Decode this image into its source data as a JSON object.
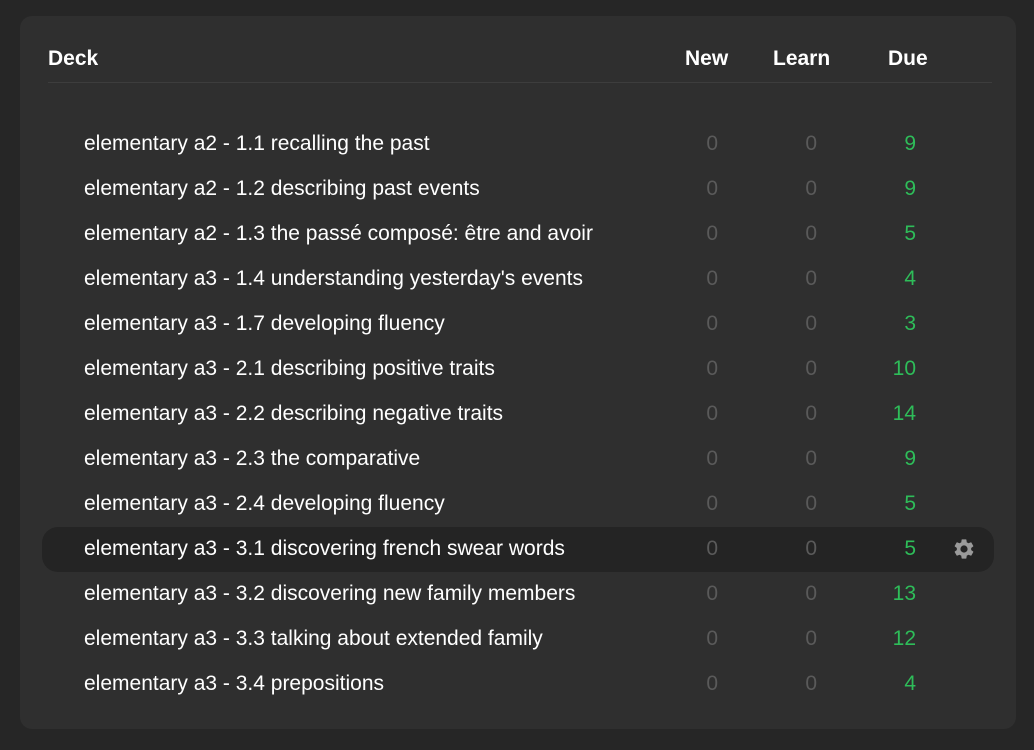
{
  "header": {
    "deck": "Deck",
    "new": "New",
    "learn": "Learn",
    "due": "Due"
  },
  "decks": [
    {
      "name": "elementary a2 - 1.1 recalling the past",
      "new": "0",
      "learn": "0",
      "due": "9"
    },
    {
      "name": "elementary a2 - 1.2 describing past events",
      "new": "0",
      "learn": "0",
      "due": "9"
    },
    {
      "name": "elementary a2 - 1.3 the passé composé: être and avoir",
      "new": "0",
      "learn": "0",
      "due": "5"
    },
    {
      "name": "elementary a3 - 1.4 understanding yesterday's events",
      "new": "0",
      "learn": "0",
      "due": "4"
    },
    {
      "name": "elementary a3 - 1.7 developing fluency",
      "new": "0",
      "learn": "0",
      "due": "3"
    },
    {
      "name": "elementary a3 - 2.1 describing positive traits",
      "new": "0",
      "learn": "0",
      "due": "10"
    },
    {
      "name": "elementary a3 - 2.2 describing negative traits",
      "new": "0",
      "learn": "0",
      "due": "14"
    },
    {
      "name": "elementary a3 - 2.3 the comparative",
      "new": "0",
      "learn": "0",
      "due": "9"
    },
    {
      "name": "elementary a3 - 2.4 developing fluency",
      "new": "0",
      "learn": "0",
      "due": "5"
    },
    {
      "name": "elementary a3 - 3.1 discovering french swear words",
      "new": "0",
      "learn": "0",
      "due": "5"
    },
    {
      "name": "elementary a3 - 3.2 discovering new family members",
      "new": "0",
      "learn": "0",
      "due": "13"
    },
    {
      "name": "elementary a3 - 3.3 talking about extended family",
      "new": "0",
      "learn": "0",
      "due": "12"
    },
    {
      "name": "elementary a3 - 3.4 prepositions",
      "new": "0",
      "learn": "0",
      "due": "4"
    }
  ],
  "current_deck_index": 9,
  "colors": {
    "due": "#2ebd59",
    "zero": "#5a5a5a",
    "text": "#ffffff"
  },
  "icons": {
    "options": "gear-icon"
  }
}
